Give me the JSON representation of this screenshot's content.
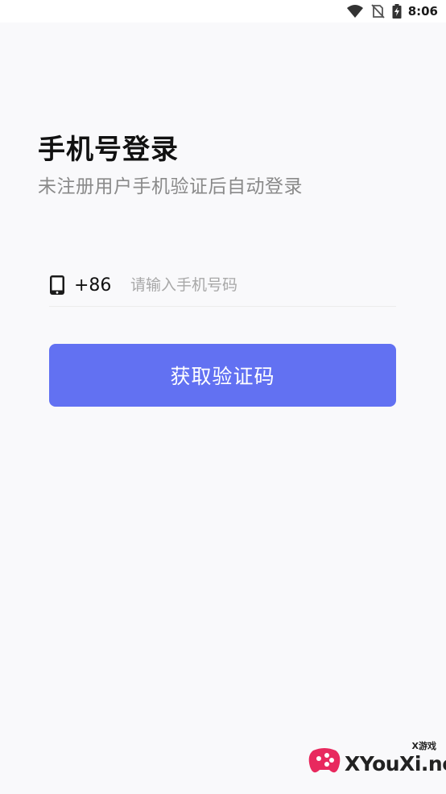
{
  "status_bar": {
    "time": "8:06",
    "icons": [
      "wifi-icon",
      "no-sim-icon",
      "battery-charging-icon"
    ]
  },
  "login": {
    "title": "手机号登录",
    "subtitle": "未注册用户手机验证后自动登录",
    "country_code": "+86",
    "phone_placeholder": "请输入手机号码",
    "phone_value": "",
    "phone_icon": "phone-icon",
    "submit_label": "获取验证码"
  },
  "watermark": {
    "small_text": "X游戏",
    "site_text": "XYouXi.net"
  },
  "colors": {
    "background": "#f9f9fb",
    "accent": "#6271f2",
    "title": "#111111",
    "subtitle": "#8a8a8a",
    "placeholder": "#a8a8a8"
  }
}
